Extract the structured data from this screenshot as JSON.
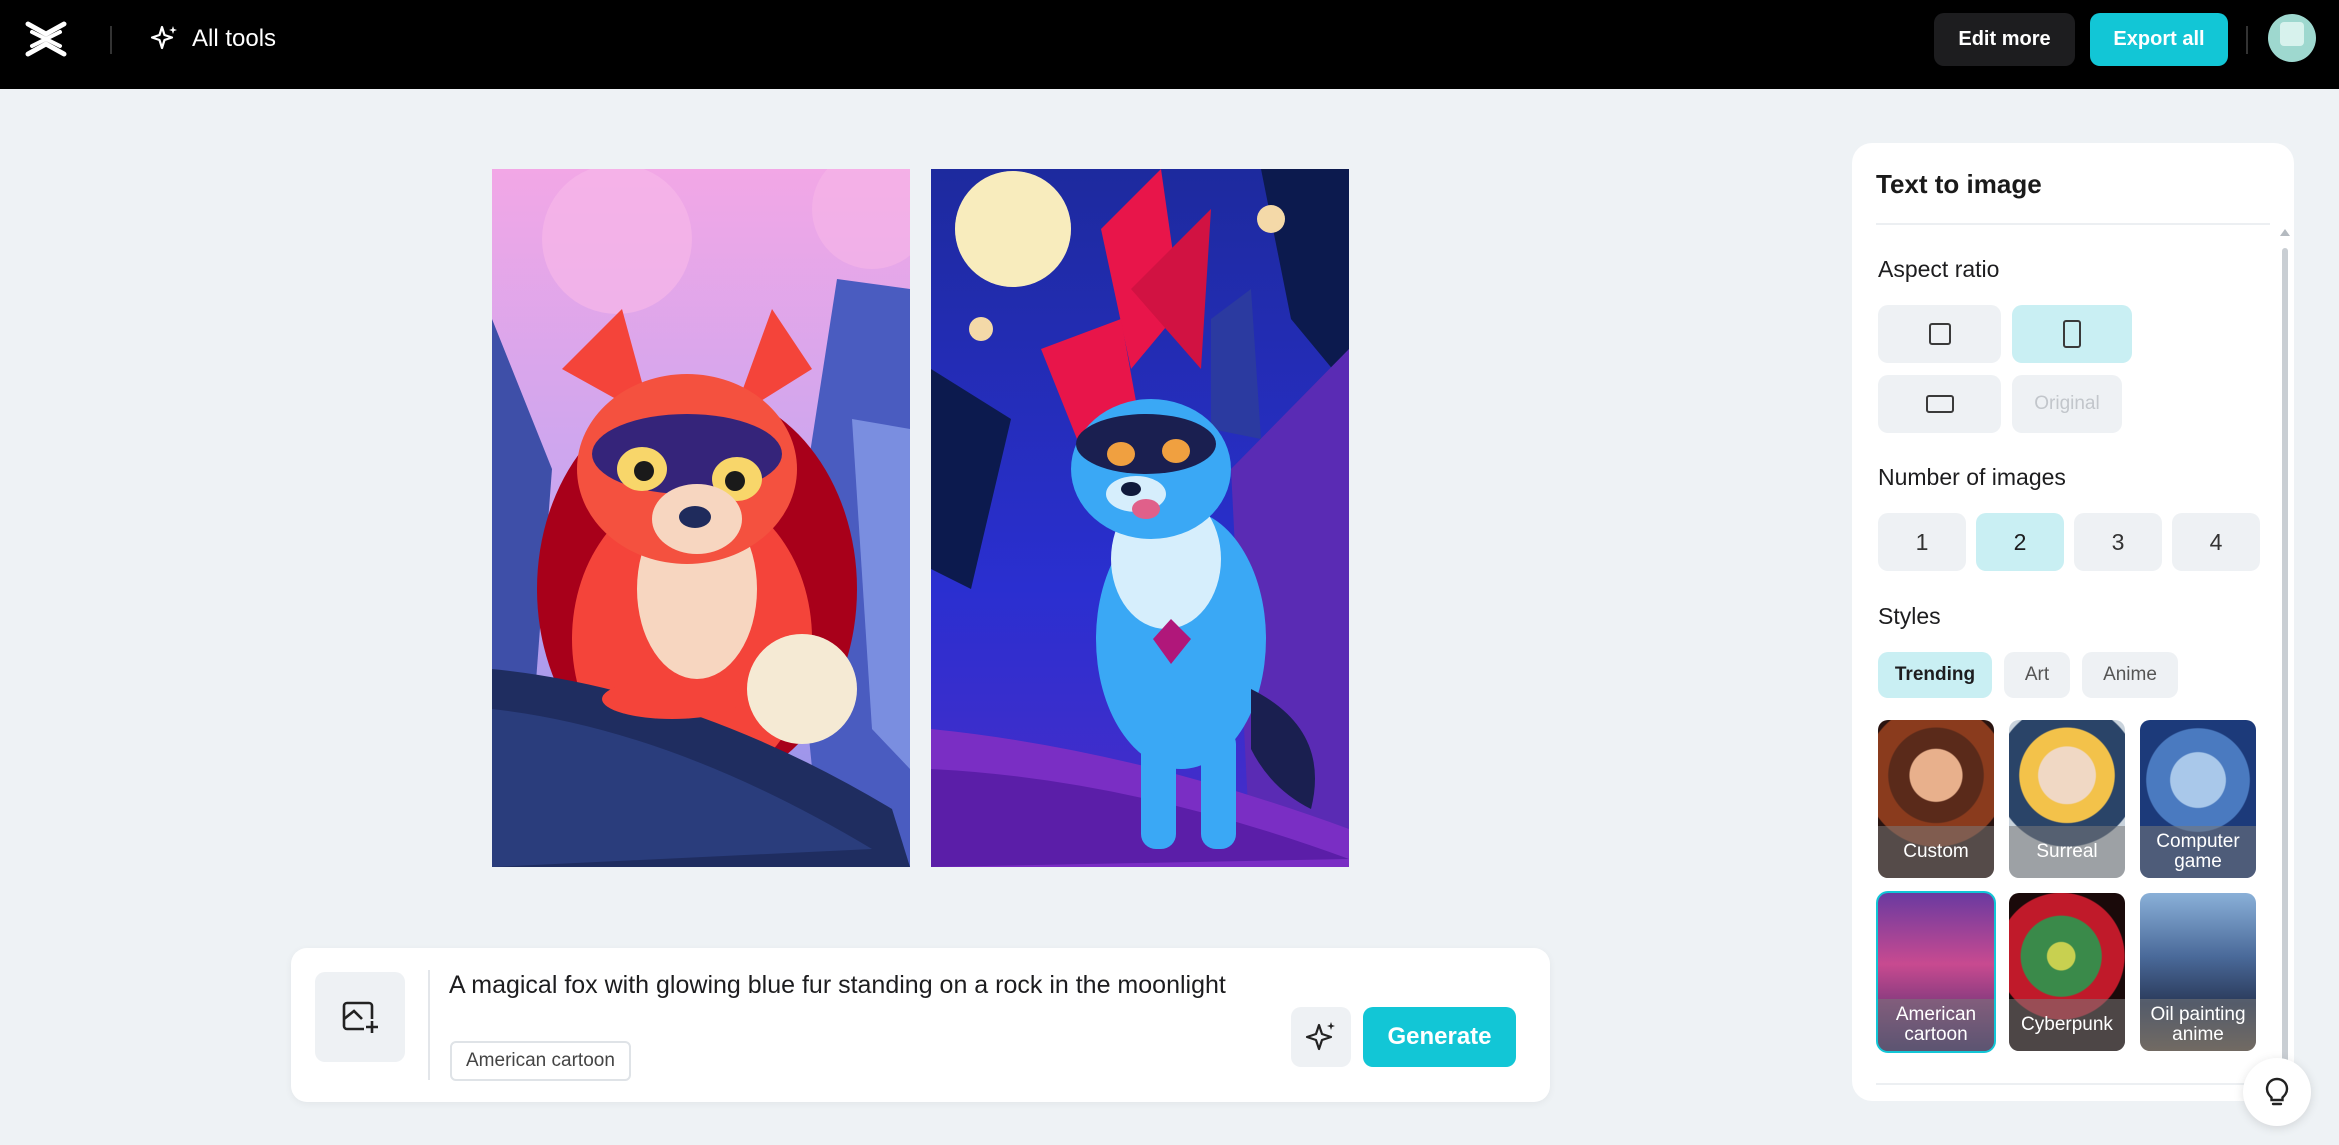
{
  "header": {
    "all_tools_label": "All tools",
    "edit_more_label": "Edit more",
    "export_all_label": "Export all"
  },
  "prompt": {
    "text": "A magical fox with glowing blue fur standing on a rock in the moonlight",
    "style_tag": "American cartoon",
    "generate_label": "Generate"
  },
  "panel": {
    "title": "Text to image",
    "aspect_ratio_label": "Aspect ratio",
    "aspect_ratio_options": [
      "square",
      "portrait",
      "landscape",
      "Original"
    ],
    "aspect_ratio_selected": "portrait",
    "original_label": "Original",
    "number_label": "Number of images",
    "numbers": [
      "1",
      "2",
      "3",
      "4"
    ],
    "number_selected": "2",
    "styles_label": "Styles",
    "style_tabs": [
      "Trending",
      "Art",
      "Anime"
    ],
    "style_tab_selected": "Trending",
    "style_cards": [
      "Custom",
      "Surreal",
      "Computer game",
      "American cartoon",
      "Cyberpunk",
      "Oil painting anime"
    ],
    "style_card_selected": "American cartoon"
  },
  "colors": {
    "accent": "#12c6d6",
    "accent_light": "#c9eff3",
    "topbar": "#000000",
    "background": "#eef2f5"
  }
}
